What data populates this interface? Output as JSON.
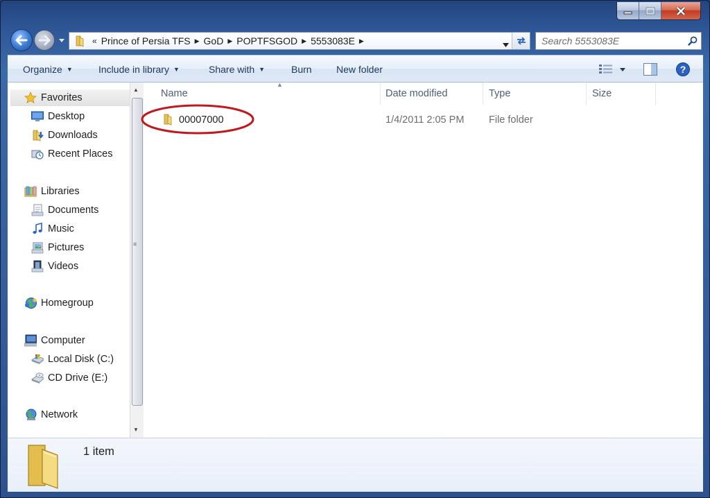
{
  "window": {
    "caption": {
      "minimize": "minimize",
      "maximize": "maximize",
      "close": "close"
    }
  },
  "address": {
    "crumbs": [
      "Prince of Persia TFS",
      "GoD",
      "POPTFSGOD",
      "5553083E"
    ],
    "separator": "«",
    "arrow": "▶"
  },
  "search": {
    "placeholder": "Search 5553083E",
    "value": ""
  },
  "toolbar": {
    "organize": "Organize",
    "include_in_library": "Include in library",
    "share_with": "Share with",
    "burn": "Burn",
    "new_folder": "New folder"
  },
  "sidebar": {
    "favorites": {
      "label": "Favorites",
      "items": [
        {
          "label": "Desktop",
          "icon": "desktop-icon"
        },
        {
          "label": "Downloads",
          "icon": "downloads-icon"
        },
        {
          "label": "Recent Places",
          "icon": "recent-places-icon"
        }
      ]
    },
    "libraries": {
      "label": "Libraries",
      "items": [
        {
          "label": "Documents",
          "icon": "documents-icon"
        },
        {
          "label": "Music",
          "icon": "music-icon"
        },
        {
          "label": "Pictures",
          "icon": "pictures-icon"
        },
        {
          "label": "Videos",
          "icon": "videos-icon"
        }
      ]
    },
    "homegroup": {
      "label": "Homegroup"
    },
    "computer": {
      "label": "Computer",
      "items": [
        {
          "label": "Local Disk (C:)",
          "icon": "local-disk-icon"
        },
        {
          "label": "CD Drive (E:)",
          "icon": "cd-drive-icon"
        }
      ]
    },
    "network": {
      "label": "Network"
    }
  },
  "columns": {
    "name": "Name",
    "date_modified": "Date modified",
    "type": "Type",
    "size": "Size"
  },
  "files": [
    {
      "name": "00007000",
      "date_modified": "1/4/2011 2:05 PM",
      "type": "File folder",
      "size": ""
    }
  ],
  "details": {
    "count": "1 item"
  },
  "colors": {
    "annotation": "#c0181c",
    "link_text": "#1e395b",
    "column_header": "#4c607a"
  }
}
